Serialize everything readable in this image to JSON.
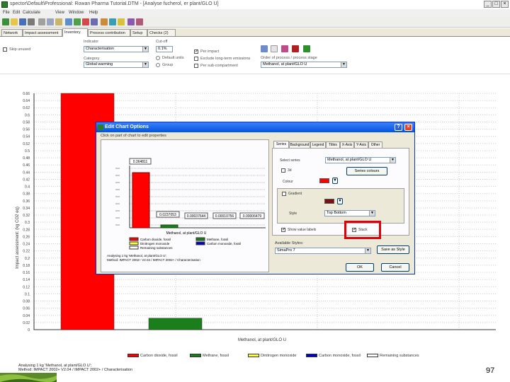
{
  "window": {
    "title": "spector\\Default\\Professional: Rowan Pharma Tutorial.DTM - [Analyse fucherol, er plant/GLO U]",
    "btn_min": "_",
    "btn_max": "□",
    "btn_close": "×"
  },
  "menu": {
    "items": [
      "File",
      "Edit",
      "Calculate",
      "View",
      "Window",
      "Help"
    ]
  },
  "tabs": {
    "items": [
      "Network",
      "Impact assessment",
      "Inventory",
      "Process contribution",
      "Setup",
      "Checks (2)"
    ],
    "active_index": 2
  },
  "options": {
    "skip_unused": "Skip unused",
    "indicator_label": "Indicator",
    "indicator_value": "Characterisation",
    "cutoff_label": "Cut-off",
    "cutoff_value": "0.1%",
    "category_label": "Category",
    "category_value": "Global warming",
    "default_units": "Default units",
    "exclude_long_term": "Exclude long-term emissions",
    "group_label": "Group",
    "per_impact": "Per impact",
    "per_sub": "Per sub-compartment",
    "order_label": "Order of process / process stage",
    "order_value": "Methanol, at plant/GLO U",
    "chart_label": "Chart"
  },
  "chart": {
    "ylabel": "Impact assessment: (kg CO2 eq)",
    "xlabel": "Methanol, at plant/GLO U",
    "legend": [
      {
        "label": "Carbon dioxide, fossil",
        "color": "#ff0000"
      },
      {
        "label": "Methane, fossil",
        "color": "#1a7f1a"
      },
      {
        "label": "Dinitrogen monoxide",
        "color": "#ffff33"
      },
      {
        "label": "Carbon monoxide, fossil",
        "color": "#0000cc"
      },
      {
        "label": "Remaining substances",
        "color": "#ffffff"
      }
    ]
  },
  "chart_data": {
    "type": "bar",
    "categories": [
      "Methanol, at plant/GLO U"
    ],
    "series": [
      {
        "name": "Carbon dioxide, fossil",
        "values": [
          0.66
        ]
      },
      {
        "name": "Methane, fossil",
        "values": [
          0.032
        ]
      },
      {
        "name": "Dinitrogen monoxide",
        "values": [
          0
        ]
      },
      {
        "name": "Carbon monoxide, fossil",
        "values": [
          0
        ]
      },
      {
        "name": "Remaining substances",
        "values": [
          0
        ]
      }
    ],
    "yticks": [
      "0.66",
      "0.64",
      "0.62",
      "0.6",
      "0.58",
      "0.56",
      "0.54",
      "0.52",
      "0.5",
      "0.48",
      "0.46",
      "0.44",
      "0.42",
      "0.4",
      "0.38",
      "0.36",
      "0.34",
      "0.32",
      "0.3",
      "0.28",
      "0.26",
      "0.24",
      "0.22",
      "0.2",
      "0.18",
      "0.16",
      "0.14",
      "0.12",
      "0.1",
      "0.08",
      "0.06",
      "0.04",
      "0.02",
      "0"
    ],
    "ylim": [
      0,
      0.66
    ],
    "ylabel": "Impact assessment: (kg CO2 eq)",
    "xlabel": "Methanol, at plant/GLO U",
    "grid": true,
    "legend_position": "bottom"
  },
  "footnote": {
    "line1": "Analysing 1 kg 'Methanol, at plant/GLO U';",
    "line2": "Method: IMPACT 2002+ V2.04 / IMPACT 2002+ / Characterisation"
  },
  "dialog": {
    "title": "Edit Chart Options",
    "btn_help": "?",
    "btn_close": "×",
    "preview_title": "Click on part of chart to edit properties",
    "preview_value_label": "0.364811",
    "preview_bar_labels": [
      "0.0237053",
      "0.00037644",
      "0.00010756",
      "0.00006479"
    ],
    "preview_xlabel": "Methanol, at plant/GLO U",
    "preview_legend": [
      "Carbon dioxide, fossil",
      "Methane, fossil",
      "Dinitrogen monoxide",
      "Carbon monoxide, fossil",
      "Remaining substances"
    ],
    "preview_foot1": "Analysing 1 kg 'Methanol, at plant/GLO U';",
    "preview_foot2": "Method: IMPACT 2002+ V2.04 / IMPACT 2002+ / Characterisation",
    "tabs": [
      "Series",
      "Background",
      "Legend",
      "Titles",
      "X-Axis",
      "Y-Axis",
      "Other"
    ],
    "select_series_label": "Select series",
    "select_series_value": "Methanol, at plant/GLO U",
    "series_colors_btn": "Series colours",
    "check_3d": "3d",
    "color_label": "Colour",
    "gradient_label": "Gradient",
    "style_label": "Style",
    "style_value": "Top Bottom",
    "show_labels": "Show value labels",
    "check_marked": "Stack",
    "available_styles_label": "Available Styles:",
    "available_styles_value": "SimaPro 7",
    "save_style_btn": "Save as Style",
    "ok_btn": "OK",
    "cancel_btn": "Cancel",
    "highlight_color": "#e0000a"
  },
  "page_number": "97"
}
